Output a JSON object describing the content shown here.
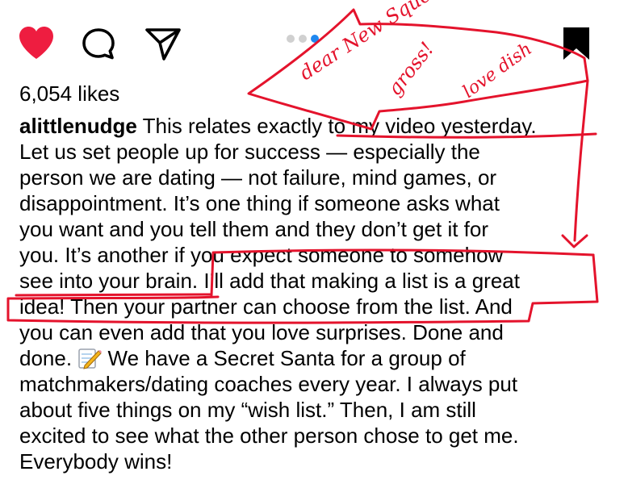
{
  "post": {
    "likes": "6,054 likes",
    "username": "alittlenudge",
    "caption_lines": [
      " This relates exactly to my video yesterday.",
      "Let us set people up for success — especially the",
      "person we are dating — not failure, mind games, or",
      "disappointment. It’s one thing if someone asks what",
      "you want and you tell them and they don’t get it for",
      "you. It’s another if you expect someone to somehow",
      "see into your brain. I’ll add that making a list is a great",
      "idea! Then your partner can choose from the list. And",
      "you can even add that you love surprises. Done and",
      "done.  ",
      "matchmakers/dating coaches every year. I always put",
      "about five things on my “wish list.” Then, I am still",
      "excited to see what the other person chose to get me.",
      "Everybody wins!"
    ],
    "line10_after_emoji": " We have a Secret Santa for a group of",
    "carousel": {
      "count": 3,
      "active_index": 2
    }
  },
  "actions": {
    "like_icon": "heart-filled-icon",
    "comment_icon": "comment-bubble-icon",
    "share_icon": "paper-plane-icon",
    "save_icon": "bookmark-filled-icon",
    "like_color": "#ee1d40"
  },
  "annotations": {
    "ink_color": "#e4132c",
    "notes": [
      "dear New Squeeze",
      "gross!",
      "love dish"
    ]
  }
}
